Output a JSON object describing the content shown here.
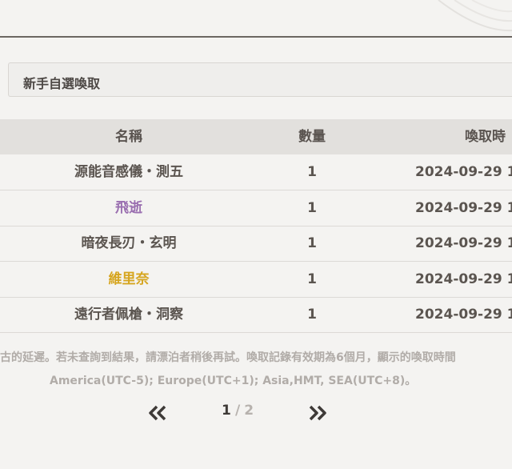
{
  "filter": {
    "selected_label": "新手自選喚取"
  },
  "table": {
    "headers": {
      "name": "名稱",
      "quantity": "數量",
      "time": "喚取時"
    },
    "rows": [
      {
        "name": "源能音感儀・測五",
        "quantity": "1",
        "time": "2024-09-29 1",
        "name_color": "#5b5550"
      },
      {
        "name": "飛逝",
        "quantity": "1",
        "time": "2024-09-29 1",
        "name_color": "#9a6fb0"
      },
      {
        "name": "暗夜長刃・玄明",
        "quantity": "1",
        "time": "2024-09-29 1",
        "name_color": "#5b5550"
      },
      {
        "name": "維里奈",
        "quantity": "1",
        "time": "2024-09-29 1",
        "name_color": "#d6a51f"
      },
      {
        "name": "遠行者佩槍・洞察",
        "quantity": "1",
        "time": "2024-09-29 1",
        "name_color": "#5b5550"
      }
    ]
  },
  "notice": {
    "line1": "古的延遲。若未查詢到結果，請漂泊者稍後再試。喚取記錄有效期為6個月，顯示的喚取時間",
    "line2": "America(UTC-5); Europe(UTC+1); Asia,HMT, SEA(UTC+8)。"
  },
  "pagination": {
    "current": "1",
    "separator": "/",
    "total": "2",
    "prev_icon": "double-chevron-left-icon",
    "next_icon": "double-chevron-right-icon"
  }
}
